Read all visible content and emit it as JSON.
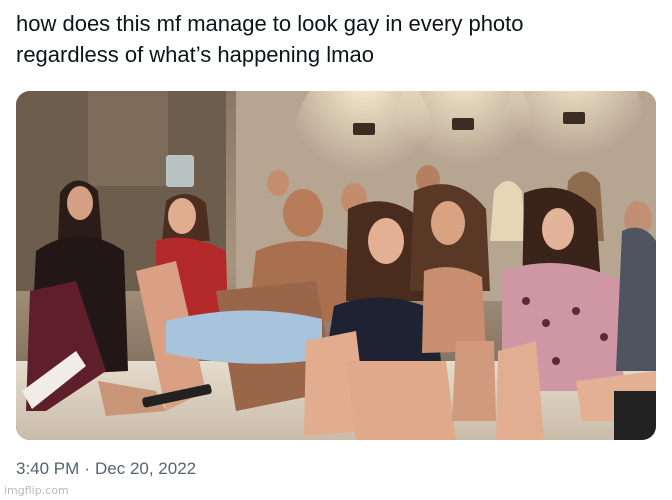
{
  "tweet": {
    "text_line1": "how does this mf manage to look gay in every photo",
    "text_line2": "regardless of what’s happening lmao",
    "time": "3:40 PM",
    "separator": "·",
    "date": "Dec 20, 2022"
  },
  "image": {
    "description_icon": "photo-icon"
  },
  "watermark": {
    "text": "imgflip.com"
  },
  "colors": {
    "text": "#0f1419",
    "meta": "#536471",
    "wall": "#b8a896",
    "ceiling_light": "#f4e2bf"
  }
}
